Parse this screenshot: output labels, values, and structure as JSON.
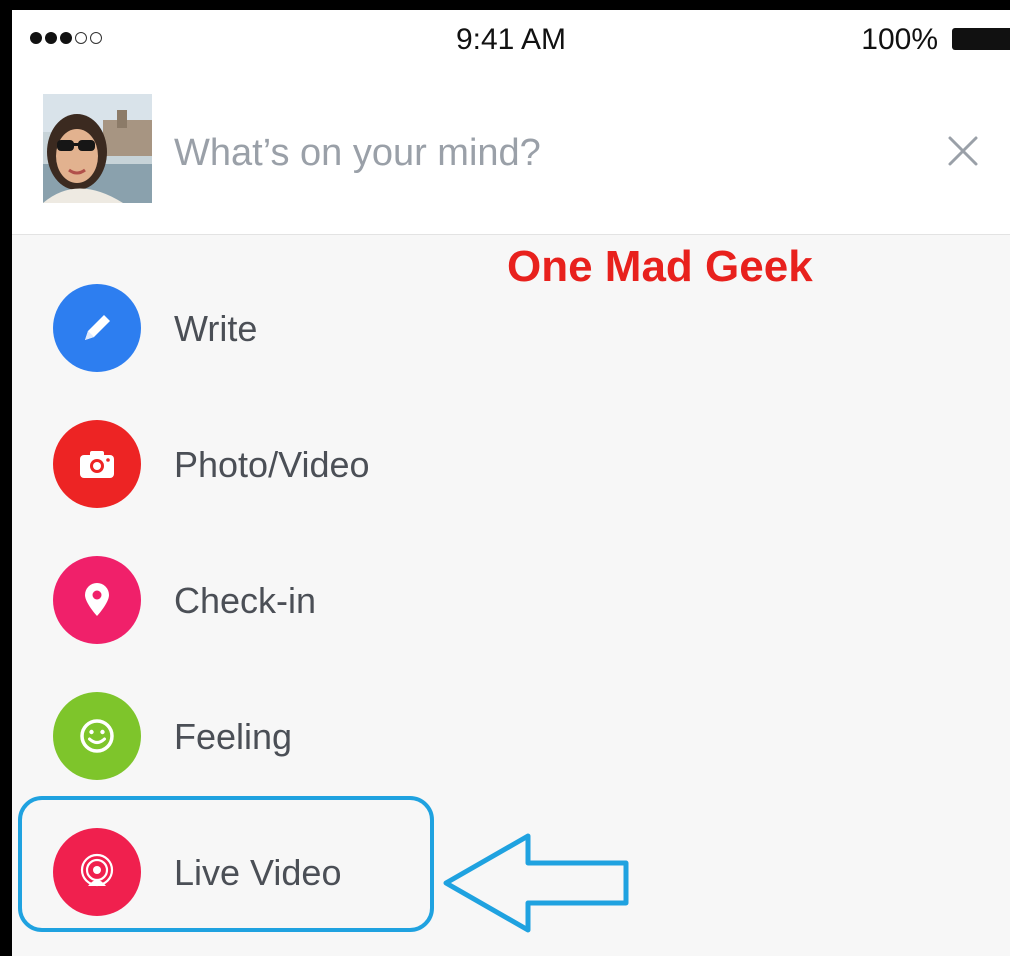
{
  "status_bar": {
    "signal_dots": [
      true,
      true,
      true,
      false,
      false
    ],
    "time": "9:41 AM",
    "battery_percent": "100%",
    "battery_level": 1.0
  },
  "composer": {
    "placeholder": "What’s on your mind?",
    "close_icon": "close-icon"
  },
  "watermark": "One Mad Geek",
  "menu": {
    "items": [
      {
        "label": "Write",
        "icon": "pencil-icon",
        "color": "#2d7ef0"
      },
      {
        "label": "Photo/Video",
        "icon": "camera-icon",
        "color": "#ed2424"
      },
      {
        "label": "Check-in",
        "icon": "location-pin-icon",
        "color": "#f0206a"
      },
      {
        "label": "Feeling",
        "icon": "smiley-icon",
        "color": "#7ec52b"
      },
      {
        "label": "Live Video",
        "icon": "live-broadcast-icon",
        "color": "#f0204e"
      }
    ]
  },
  "annotation": {
    "highlight_color": "#1fa2e0",
    "target": "Live Video"
  }
}
